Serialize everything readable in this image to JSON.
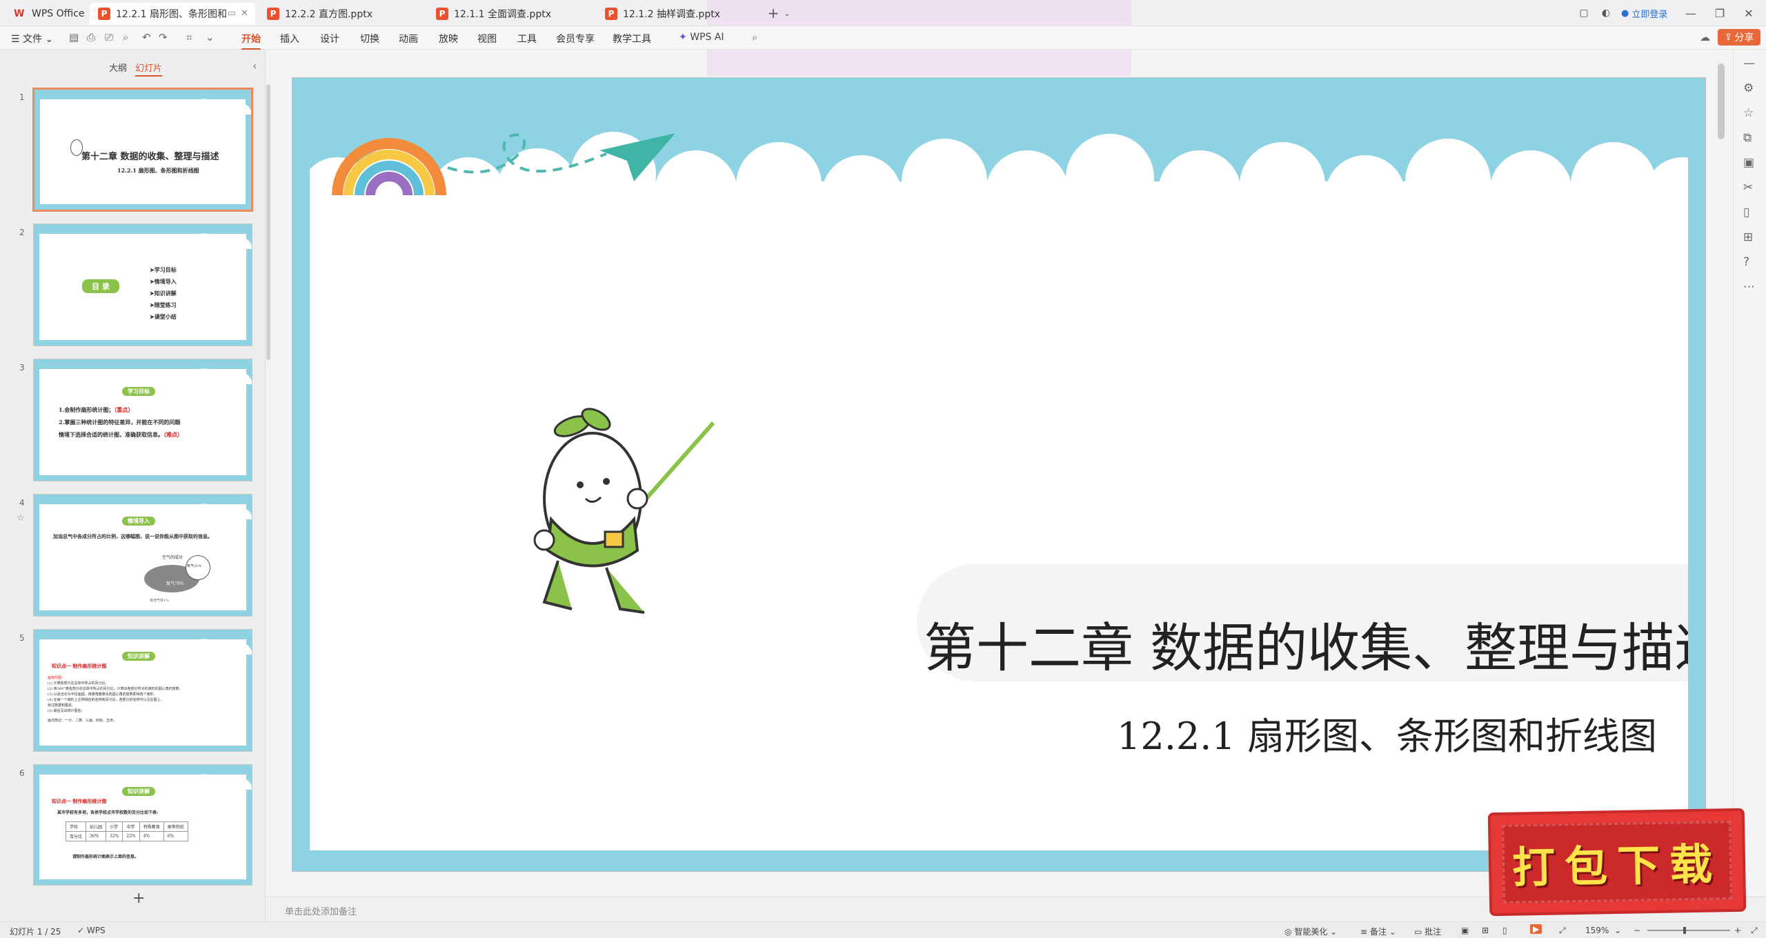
{
  "app": {
    "name": "WPS Office"
  },
  "tabs": [
    {
      "label": "12.2.1 扇形图、条形图和折线",
      "active": true
    },
    {
      "label": "12.2.2 直方图.pptx",
      "active": false
    },
    {
      "label": "12.1.1 全面调查.pptx",
      "active": false
    },
    {
      "label": "12.1.2 抽样调查.pptx",
      "active": false
    }
  ],
  "titlebar": {
    "login": "立即登录"
  },
  "menubar": {
    "file": "文件",
    "items": [
      "开始",
      "插入",
      "设计",
      "切换",
      "动画",
      "放映",
      "视图",
      "工具",
      "会员专享",
      "教学工具"
    ],
    "wps_ai": "WPS AI",
    "share": "分享"
  },
  "leftpanel": {
    "tab_outline": "大纲",
    "tab_slides": "幻灯片",
    "add": "+",
    "slides": [
      {
        "num": "1",
        "title": "第十二章 数据的收集、整理与描述",
        "sub": "12.2.1 扇形图、条形图和折线图"
      },
      {
        "num": "2",
        "badge": "目 录",
        "items": [
          "➤学习目标",
          "➤情境导入",
          "➤知识讲解",
          "➤随堂练习",
          "➤课堂小结"
        ]
      },
      {
        "num": "3",
        "badge": "学习目标",
        "lines": [
          "1.会制作扇形统计图；",
          "（重点）",
          "2.掌握三种统计图的特征差异，并能在不同的问题",
          "情境下选择合适的统计图，准确获取信息。",
          "（难点）"
        ]
      },
      {
        "num": "4",
        "badge": "情境导入",
        "text": "加油总气中各成分所占的比例，这哪幅图，说一说你能从图中获取的信息。",
        "pie_title": "空气的成分",
        "pie_a": "氧气21%",
        "pie_b": "氮气78%",
        "pie_c": "其他气体1%"
      },
      {
        "num": "5",
        "badge": "知识讲解",
        "head": "知识点一 制作扇形统计图",
        "lines": [
          "画扇形图:",
          "(1) 计算各部分在总体中所占的百分比;",
          "(2) 用360°乘各部分在总体中所占的百分比，计算出各部分所对的扇形的圆心角的度数;",
          "(3) 以适当长为半径画圆，用量角器量出各圆心角的度数即得各个扇形;",
          "(4) 在每一个扇形上注明相应的名称和百分比，各部分的名称可以注在图上。",
          "标注数据和图名;",
          "(5) 最后写出统计图名。",
          "画法简记：一计、二算、三画、四标、五命。"
        ]
      },
      {
        "num": "6",
        "badge": "知识讲解",
        "head": "知识点一 制作扇形统计图",
        "text": "某市学校有多项，各类学校点市学校数的百分比如下表:",
        "table_header": [
          "学校",
          "幼儿园",
          "小学",
          "中学",
          "特殊教育",
          "高等院校"
        ],
        "table_row": [
          "百分比",
          "36%",
          "32%",
          "22%",
          "4%",
          "6%"
        ],
        "foot": "请制作扇形统计图表示上面的信息。"
      }
    ]
  },
  "slide": {
    "title": "第十二章  数据的收集、整理与描述",
    "subtitle": "12.2.1 扇形图、条形图和折线图"
  },
  "notes": {
    "placeholder": "单击此处添加备注"
  },
  "status": {
    "slide_count": "幻灯片 1 / 25",
    "wps": "WPS",
    "beautify": "智能美化",
    "notes": "备注",
    "comments": "批注",
    "zoom": "159%"
  },
  "banner": {
    "text": "打包下载"
  },
  "colors": {
    "accent": "#d9542c",
    "slide_border": "#8dd3e3",
    "banner": "#e63936"
  }
}
